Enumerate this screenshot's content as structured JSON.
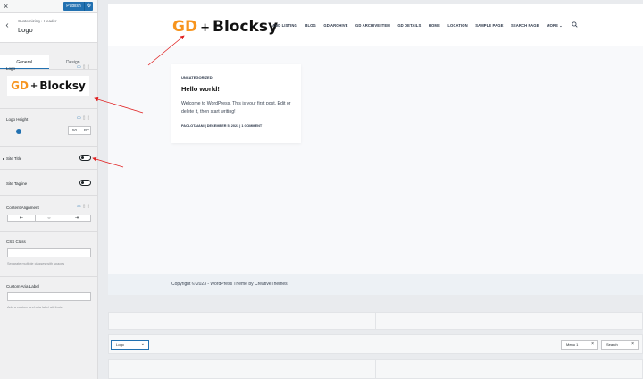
{
  "topbar": {
    "close_icon": "×",
    "publish_label": "Publish",
    "gear_icon": "⚙"
  },
  "section": {
    "back_icon": "‹",
    "breadcrumb": "Customizing › Header",
    "title": "Logo"
  },
  "tabs": [
    {
      "label": "General",
      "active": true
    },
    {
      "label": "Design",
      "active": false
    }
  ],
  "options": {
    "logo_label": "Logo",
    "logo_preview": {
      "gd": "GD",
      "plus": "+",
      "blocksy": "Blocksy"
    },
    "logo_height_label": "Logo Height",
    "logo_height_value": "50",
    "logo_height_unit": "PX",
    "site_title_label": "Site Title",
    "site_tagline_label": "Site Tagline",
    "content_alignment_label": "Content Alignment",
    "align_icons": [
      "⇤",
      "⇔",
      "⇥"
    ],
    "css_class_label": "CSS Class",
    "css_class_help": "Separate multiple classes with spaces",
    "aria_label_label": "Custom Aria Label",
    "aria_label_help": "Add a custom and aria label attribute"
  },
  "site": {
    "logo": {
      "gd": "GD",
      "plus": "+",
      "blocksy": "Blocksy"
    },
    "nav": [
      "ADD LISTING",
      "BLOG",
      "GD ARCHIVE",
      "GD ARCHIVE ITEM",
      "GD DETAILS",
      "HOME",
      "LOCATION",
      "SAMPLE PAGE",
      "SEARCH PAGE",
      "MORE ⌄"
    ],
    "post": {
      "category": "UNCATEGORIZED",
      "title": "Hello world!",
      "excerpt": "Welcome to WordPress. This is your first post. Edit or delete it, then start writing!",
      "meta": "PAOLOTAIANI  |  DECEMBER 5, 2023  |  1 COMMENT"
    },
    "copyright": "Copyright © 2023 - WordPress Theme by CreativeThemes"
  },
  "builder": {
    "logo_chip": "Logo",
    "menu_chip": "Menu 1",
    "search_chip": "Search",
    "close_glyph": "×"
  },
  "colors": {
    "accent": "#2271b1",
    "logo_orange": "#f7941d",
    "annotation_red": "#e02020"
  }
}
